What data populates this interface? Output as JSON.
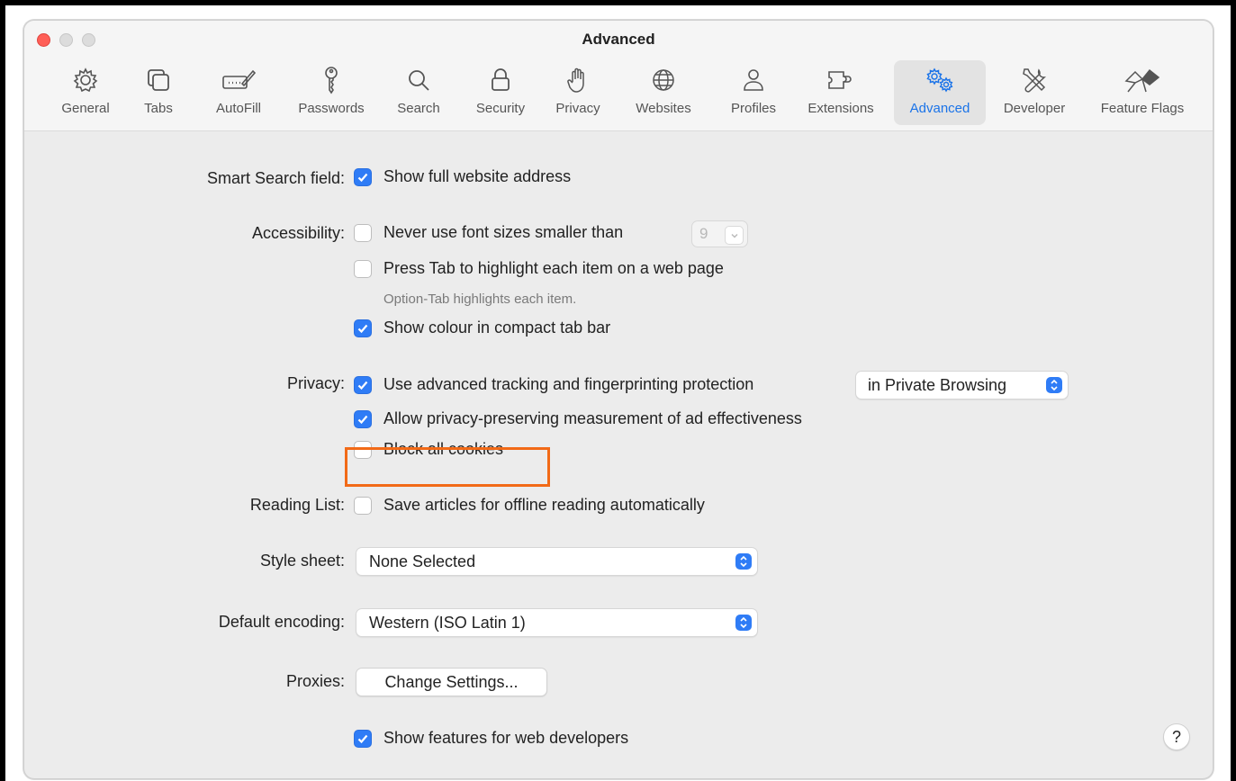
{
  "window": {
    "title": "Advanced"
  },
  "toolbar": {
    "tabs": [
      {
        "label": "General",
        "icon": "gear-icon"
      },
      {
        "label": "Tabs",
        "icon": "tabs-icon"
      },
      {
        "label": "AutoFill",
        "icon": "autofill-icon"
      },
      {
        "label": "Passwords",
        "icon": "key-icon"
      },
      {
        "label": "Search",
        "icon": "search-icon"
      },
      {
        "label": "Security",
        "icon": "lock-icon"
      },
      {
        "label": "Privacy",
        "icon": "hand-icon"
      },
      {
        "label": "Websites",
        "icon": "globe-icon"
      },
      {
        "label": "Profiles",
        "icon": "person-icon"
      },
      {
        "label": "Extensions",
        "icon": "puzzle-icon"
      },
      {
        "label": "Advanced",
        "icon": "gears-icon",
        "active": true
      },
      {
        "label": "Developer",
        "icon": "tools-icon"
      },
      {
        "label": "Feature Flags",
        "icon": "flags-icon"
      }
    ]
  },
  "settings": {
    "smart_search": {
      "label": "Smart Search field:",
      "option": "Show full website address",
      "checked": true
    },
    "accessibility": {
      "label": "Accessibility:",
      "font_size": {
        "text": "Never use font sizes smaller than",
        "value": "9",
        "checked": false
      },
      "press_tab": {
        "text": "Press Tab to highlight each item on a web page",
        "checked": false
      },
      "press_tab_hint": "Option-Tab highlights each item.",
      "show_colour": {
        "text": "Show colour in compact tab bar",
        "checked": true
      }
    },
    "privacy": {
      "label": "Privacy:",
      "tracking": {
        "text": "Use advanced tracking and fingerprinting protection",
        "checked": true,
        "scope": "in Private Browsing"
      },
      "ad_measurement": {
        "text": "Allow privacy-preserving measurement of ad effectiveness",
        "checked": true
      },
      "block_cookies": {
        "text": "Block all cookies",
        "checked": false
      }
    },
    "reading_list": {
      "label": "Reading List:",
      "text": "Save articles for offline reading automatically",
      "checked": false
    },
    "style_sheet": {
      "label": "Style sheet:",
      "value": "None Selected"
    },
    "encoding": {
      "label": "Default encoding:",
      "value": "Western (ISO Latin 1)"
    },
    "proxies": {
      "label": "Proxies:",
      "button": "Change Settings..."
    },
    "developer": {
      "text": "Show features for web developers",
      "checked": true
    },
    "help": "?"
  },
  "colors": {
    "accent": "#2f7cf6",
    "highlight": "#f26a17"
  }
}
